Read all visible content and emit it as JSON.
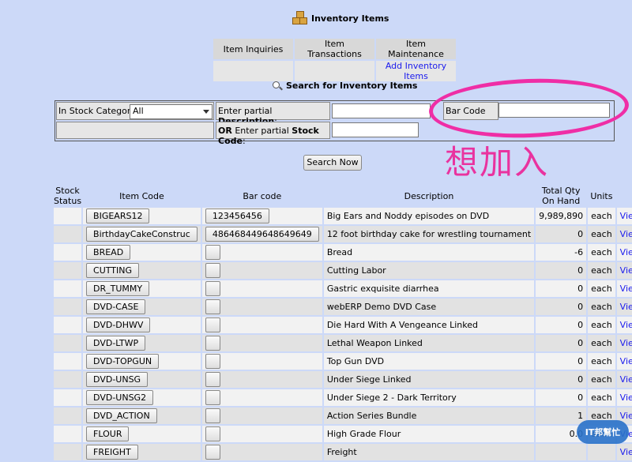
{
  "page": {
    "title": "Inventory Items",
    "search_title": "Search for Inventory Items"
  },
  "menu": {
    "headers": [
      "Item Inquiries",
      "Item Transactions",
      "Item Maintenance"
    ],
    "link": "Add Inventory Items"
  },
  "search_form": {
    "stock_category_label": "In Stock Category:",
    "stock_category_value": "All",
    "desc_label_prefix": "Enter partial ",
    "desc_label_bold": "Description",
    "desc_label_suffix": ":",
    "barcode_label": "Bar Code",
    "or_label": "OR",
    "code_label_prefix": " Enter partial ",
    "code_label_bold": "Stock Code",
    "code_label_suffix": ":",
    "search_button": "Search Now"
  },
  "annotation": {
    "text": "想加入"
  },
  "table": {
    "columns": [
      "Stock Status",
      "Item Code",
      "Bar code",
      "Description",
      "Total Qty On Hand",
      "Units"
    ],
    "view_label": "View",
    "rows": [
      {
        "code": "BIGEARS12",
        "barcode": "123456456",
        "description": "Big Ears and Noddy episodes on DVD",
        "qty": "9,989,890",
        "units": "each"
      },
      {
        "code": "BirthdayCakeConstruc",
        "barcode": "486468449648649649",
        "description": "12 foot birthday cake for wrestling tournament",
        "qty": "0",
        "units": "each"
      },
      {
        "code": "BREAD",
        "barcode": "",
        "description": "Bread",
        "qty": "-6",
        "units": "each"
      },
      {
        "code": "CUTTING",
        "barcode": "",
        "description": "Cutting Labor",
        "qty": "0",
        "units": "each"
      },
      {
        "code": "DR_TUMMY",
        "barcode": "",
        "description": "Gastric exquisite diarrhea",
        "qty": "0",
        "units": "each"
      },
      {
        "code": "DVD-CASE",
        "barcode": "",
        "description": "webERP Demo DVD Case",
        "qty": "0",
        "units": "each"
      },
      {
        "code": "DVD-DHWV",
        "barcode": "",
        "description": "Die Hard With A Vengeance Linked",
        "qty": "0",
        "units": "each"
      },
      {
        "code": "DVD-LTWP",
        "barcode": "",
        "description": "Lethal Weapon Linked",
        "qty": "0",
        "units": "each"
      },
      {
        "code": "DVD-TOPGUN",
        "barcode": "",
        "description": "Top Gun DVD",
        "qty": "0",
        "units": "each"
      },
      {
        "code": "DVD-UNSG",
        "barcode": "",
        "description": "Under Siege Linked",
        "qty": "0",
        "units": "each"
      },
      {
        "code": "DVD-UNSG2",
        "barcode": "",
        "description": "Under Siege 2 - Dark Territory",
        "qty": "0",
        "units": "each"
      },
      {
        "code": "DVD_ACTION",
        "barcode": "",
        "description": "Action Series Bundle",
        "qty": "1",
        "units": "each"
      },
      {
        "code": "FLOUR",
        "barcode": "",
        "description": "High Grade Flour",
        "qty": "0.0",
        "units": "each"
      },
      {
        "code": "FREIGHT",
        "barcode": "",
        "description": "Freight",
        "qty": "",
        "units": ""
      }
    ]
  },
  "watermark": {
    "text": "IT邦幫忙"
  }
}
